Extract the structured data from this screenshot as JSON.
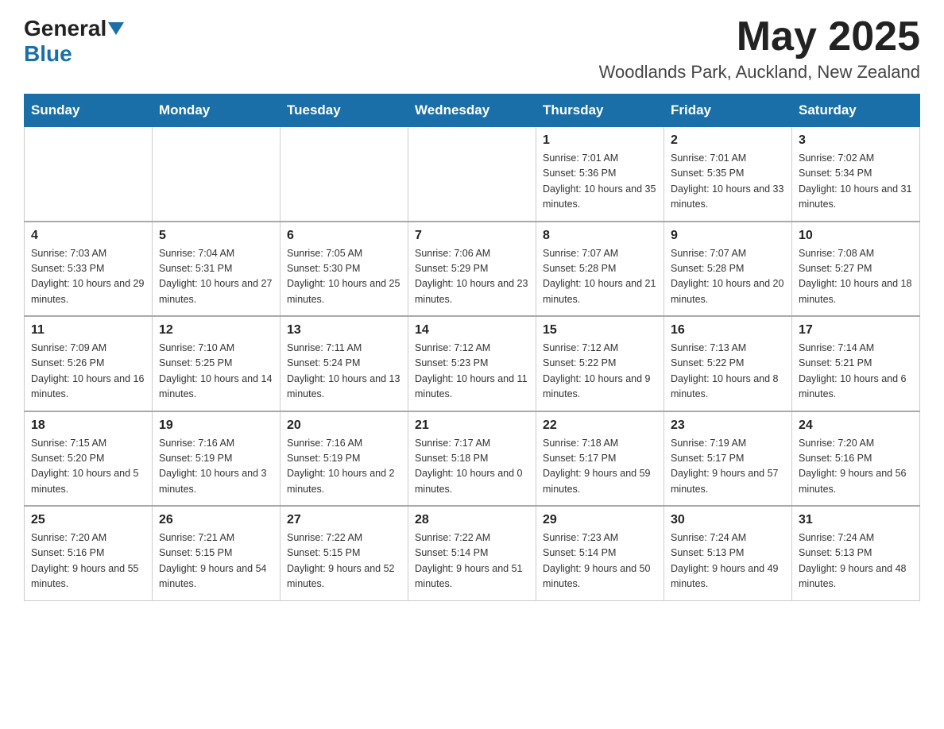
{
  "header": {
    "logo_general": "General",
    "logo_blue": "Blue",
    "month_year": "May 2025",
    "location": "Woodlands Park, Auckland, New Zealand"
  },
  "days_of_week": [
    "Sunday",
    "Monday",
    "Tuesday",
    "Wednesday",
    "Thursday",
    "Friday",
    "Saturday"
  ],
  "weeks": [
    [
      {
        "day": "",
        "info": ""
      },
      {
        "day": "",
        "info": ""
      },
      {
        "day": "",
        "info": ""
      },
      {
        "day": "",
        "info": ""
      },
      {
        "day": "1",
        "info": "Sunrise: 7:01 AM\nSunset: 5:36 PM\nDaylight: 10 hours and 35 minutes."
      },
      {
        "day": "2",
        "info": "Sunrise: 7:01 AM\nSunset: 5:35 PM\nDaylight: 10 hours and 33 minutes."
      },
      {
        "day": "3",
        "info": "Sunrise: 7:02 AM\nSunset: 5:34 PM\nDaylight: 10 hours and 31 minutes."
      }
    ],
    [
      {
        "day": "4",
        "info": "Sunrise: 7:03 AM\nSunset: 5:33 PM\nDaylight: 10 hours and 29 minutes."
      },
      {
        "day": "5",
        "info": "Sunrise: 7:04 AM\nSunset: 5:31 PM\nDaylight: 10 hours and 27 minutes."
      },
      {
        "day": "6",
        "info": "Sunrise: 7:05 AM\nSunset: 5:30 PM\nDaylight: 10 hours and 25 minutes."
      },
      {
        "day": "7",
        "info": "Sunrise: 7:06 AM\nSunset: 5:29 PM\nDaylight: 10 hours and 23 minutes."
      },
      {
        "day": "8",
        "info": "Sunrise: 7:07 AM\nSunset: 5:28 PM\nDaylight: 10 hours and 21 minutes."
      },
      {
        "day": "9",
        "info": "Sunrise: 7:07 AM\nSunset: 5:28 PM\nDaylight: 10 hours and 20 minutes."
      },
      {
        "day": "10",
        "info": "Sunrise: 7:08 AM\nSunset: 5:27 PM\nDaylight: 10 hours and 18 minutes."
      }
    ],
    [
      {
        "day": "11",
        "info": "Sunrise: 7:09 AM\nSunset: 5:26 PM\nDaylight: 10 hours and 16 minutes."
      },
      {
        "day": "12",
        "info": "Sunrise: 7:10 AM\nSunset: 5:25 PM\nDaylight: 10 hours and 14 minutes."
      },
      {
        "day": "13",
        "info": "Sunrise: 7:11 AM\nSunset: 5:24 PM\nDaylight: 10 hours and 13 minutes."
      },
      {
        "day": "14",
        "info": "Sunrise: 7:12 AM\nSunset: 5:23 PM\nDaylight: 10 hours and 11 minutes."
      },
      {
        "day": "15",
        "info": "Sunrise: 7:12 AM\nSunset: 5:22 PM\nDaylight: 10 hours and 9 minutes."
      },
      {
        "day": "16",
        "info": "Sunrise: 7:13 AM\nSunset: 5:22 PM\nDaylight: 10 hours and 8 minutes."
      },
      {
        "day": "17",
        "info": "Sunrise: 7:14 AM\nSunset: 5:21 PM\nDaylight: 10 hours and 6 minutes."
      }
    ],
    [
      {
        "day": "18",
        "info": "Sunrise: 7:15 AM\nSunset: 5:20 PM\nDaylight: 10 hours and 5 minutes."
      },
      {
        "day": "19",
        "info": "Sunrise: 7:16 AM\nSunset: 5:19 PM\nDaylight: 10 hours and 3 minutes."
      },
      {
        "day": "20",
        "info": "Sunrise: 7:16 AM\nSunset: 5:19 PM\nDaylight: 10 hours and 2 minutes."
      },
      {
        "day": "21",
        "info": "Sunrise: 7:17 AM\nSunset: 5:18 PM\nDaylight: 10 hours and 0 minutes."
      },
      {
        "day": "22",
        "info": "Sunrise: 7:18 AM\nSunset: 5:17 PM\nDaylight: 9 hours and 59 minutes."
      },
      {
        "day": "23",
        "info": "Sunrise: 7:19 AM\nSunset: 5:17 PM\nDaylight: 9 hours and 57 minutes."
      },
      {
        "day": "24",
        "info": "Sunrise: 7:20 AM\nSunset: 5:16 PM\nDaylight: 9 hours and 56 minutes."
      }
    ],
    [
      {
        "day": "25",
        "info": "Sunrise: 7:20 AM\nSunset: 5:16 PM\nDaylight: 9 hours and 55 minutes."
      },
      {
        "day": "26",
        "info": "Sunrise: 7:21 AM\nSunset: 5:15 PM\nDaylight: 9 hours and 54 minutes."
      },
      {
        "day": "27",
        "info": "Sunrise: 7:22 AM\nSunset: 5:15 PM\nDaylight: 9 hours and 52 minutes."
      },
      {
        "day": "28",
        "info": "Sunrise: 7:22 AM\nSunset: 5:14 PM\nDaylight: 9 hours and 51 minutes."
      },
      {
        "day": "29",
        "info": "Sunrise: 7:23 AM\nSunset: 5:14 PM\nDaylight: 9 hours and 50 minutes."
      },
      {
        "day": "30",
        "info": "Sunrise: 7:24 AM\nSunset: 5:13 PM\nDaylight: 9 hours and 49 minutes."
      },
      {
        "day": "31",
        "info": "Sunrise: 7:24 AM\nSunset: 5:13 PM\nDaylight: 9 hours and 48 minutes."
      }
    ]
  ]
}
